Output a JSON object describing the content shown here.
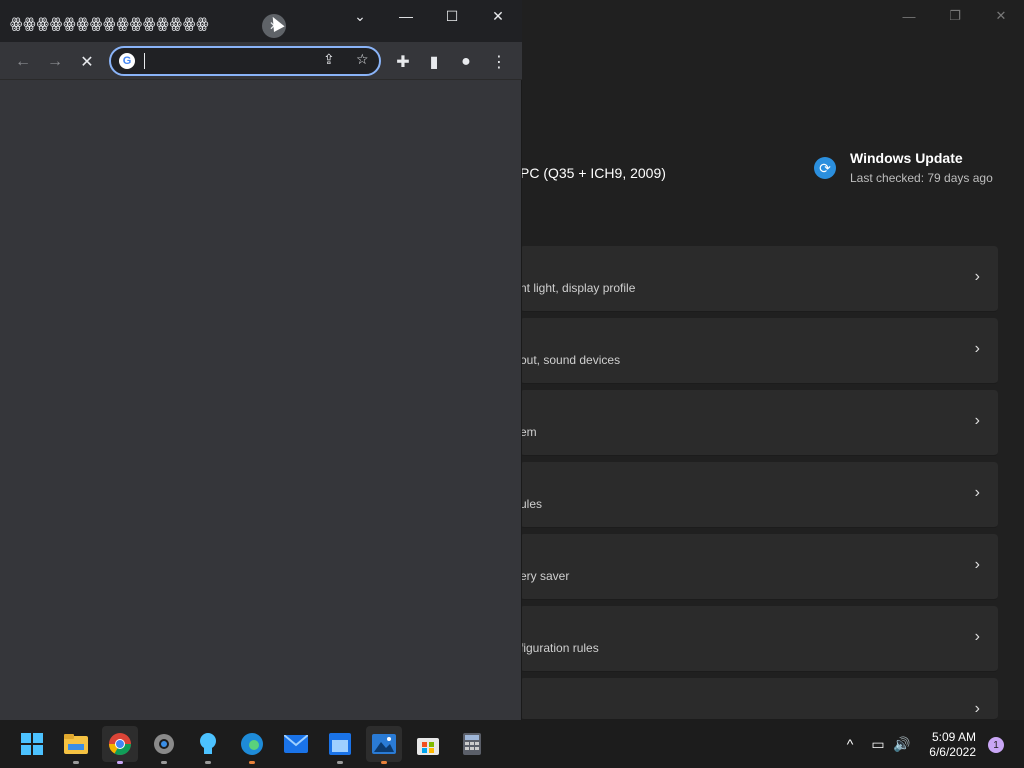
{
  "settings": {
    "window_controls": {
      "min": "—",
      "restore": "❐",
      "close": "✕"
    },
    "device_text": "PC (Q35 + ICH9, 2009)",
    "windows_update": {
      "title": "Windows Update",
      "subtitle": "Last checked: 79 days ago"
    },
    "cards": [
      {
        "desc": "nt light, display profile"
      },
      {
        "desc": "out, sound devices"
      },
      {
        "desc": "em"
      },
      {
        "desc": "ules"
      },
      {
        "desc": "ery saver"
      },
      {
        "desc": "figuration rules"
      },
      {
        "desc": ""
      }
    ]
  },
  "chrome": {
    "tab_title": "ꙮꙮꙮꙮꙮꙮꙮꙮꙮꙮꙮꙮꙮꙮꙮ",
    "tab_close": "✕",
    "controls": {
      "dropdown": "⌄",
      "min": "—",
      "max": "☐",
      "close": "✕"
    },
    "toolbar": {
      "back": "←",
      "forward": "→",
      "stop": "✕",
      "share": "⇪",
      "star": "☆",
      "extensions": "✚",
      "sidepanel": "▮",
      "profile": "●",
      "menu": "⋮"
    },
    "omnibox": {
      "value": "",
      "google": "G"
    }
  },
  "taskbar": {
    "icons": [
      "start-icon",
      "file-explorer-icon",
      "chrome-icon",
      "settings-icon",
      "tips-icon",
      "edge-icon",
      "mail-icon",
      "calendar-icon",
      "photos-icon",
      "store-icon",
      "calculator-icon"
    ],
    "tray": {
      "chevron": "^",
      "network": "▭",
      "volume": "🔊"
    },
    "clock": {
      "time": "5:09 AM",
      "date": "6/6/2022"
    },
    "notification_count": "1"
  }
}
